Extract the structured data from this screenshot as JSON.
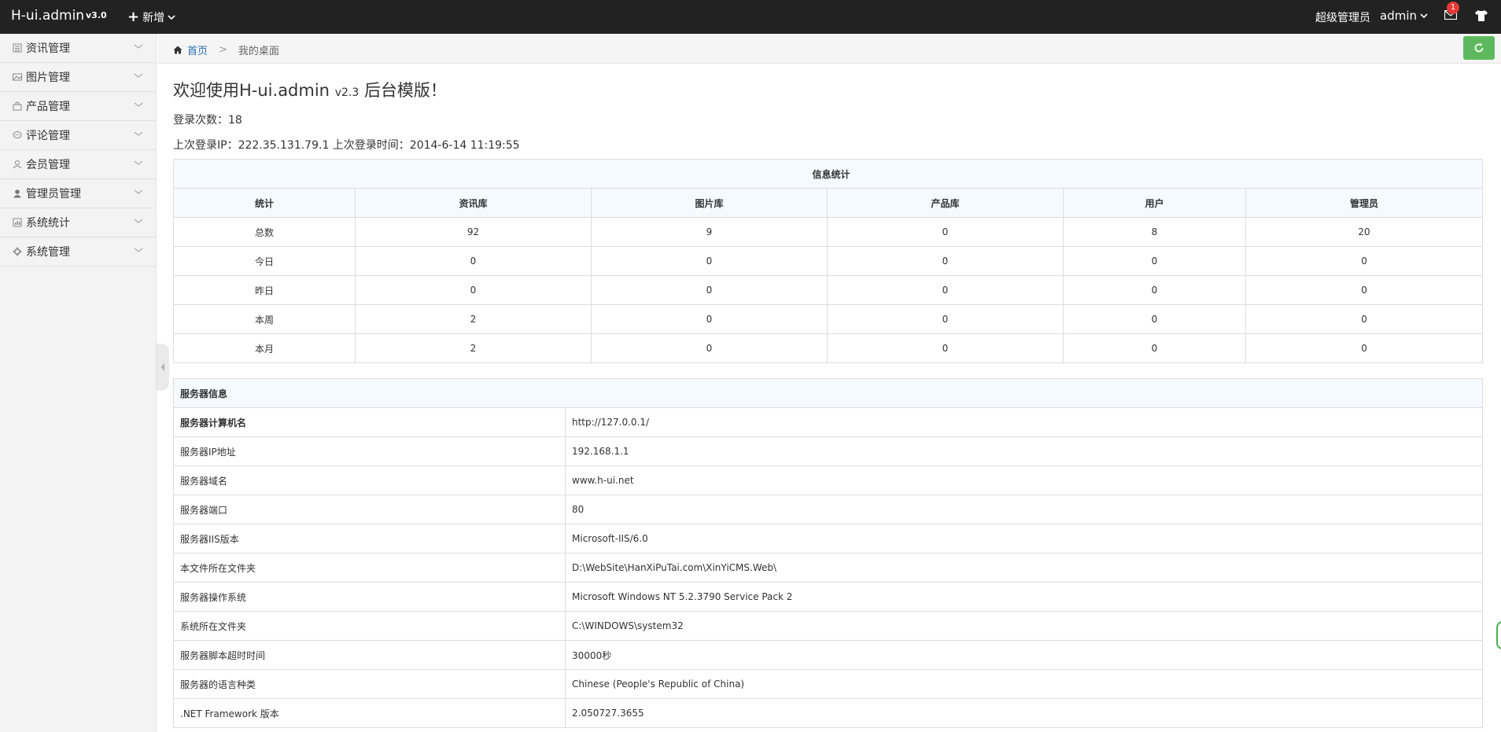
{
  "topbar": {
    "brand": "H-ui.admin",
    "version": "v3.0",
    "add_label": "新增",
    "role": "超级管理员",
    "user": "admin",
    "message_count": "1"
  },
  "sidebar": {
    "items": [
      {
        "label": "资讯管理",
        "icon": "news-icon"
      },
      {
        "label": "图片管理",
        "icon": "image-icon"
      },
      {
        "label": "产品管理",
        "icon": "bag-icon"
      },
      {
        "label": "评论管理",
        "icon": "comment-icon"
      },
      {
        "label": "会员管理",
        "icon": "member-icon"
      },
      {
        "label": "管理员管理",
        "icon": "admin-user-icon"
      },
      {
        "label": "系统统计",
        "icon": "stats-icon"
      },
      {
        "label": "系统管理",
        "icon": "gear-icon"
      }
    ]
  },
  "breadcrumb": {
    "home": "首页",
    "separator": ">",
    "current": "我的桌面"
  },
  "welcome": {
    "prefix": "欢迎使用H-ui.admin",
    "version": "v2.3",
    "suffix": "后台模版！"
  },
  "login": {
    "count_text": "登录次数：18",
    "last_text": "上次登录IP：222.35.131.79.1 上次登录时间：2014-6-14 11:19:55"
  },
  "stats": {
    "caption": "信息统计",
    "headers": [
      "统计",
      "资讯库",
      "图片库",
      "产品库",
      "用户",
      "管理员"
    ],
    "rows": [
      [
        "总数",
        "92",
        "9",
        "0",
        "8",
        "20"
      ],
      [
        "今日",
        "0",
        "0",
        "0",
        "0",
        "0"
      ],
      [
        "昨日",
        "0",
        "0",
        "0",
        "0",
        "0"
      ],
      [
        "本周",
        "2",
        "0",
        "0",
        "0",
        "0"
      ],
      [
        "本月",
        "2",
        "0",
        "0",
        "0",
        "0"
      ]
    ]
  },
  "server": {
    "caption": "服务器信息",
    "rows": [
      [
        "服务器计算机名",
        "http://127.0.0.1/"
      ],
      [
        "服务器IP地址",
        "192.168.1.1"
      ],
      [
        "服务器域名",
        "www.h-ui.net"
      ],
      [
        "服务器端口",
        "80"
      ],
      [
        "服务器IIS版本",
        "Microsoft-IIS/6.0"
      ],
      [
        "本文件所在文件夹",
        "D:\\WebSite\\HanXiPuTai.com\\XinYiCMS.Web\\"
      ],
      [
        "服务器操作系统",
        "Microsoft Windows NT 5.2.3790 Service Pack 2"
      ],
      [
        "系统所在文件夹",
        "C:\\WINDOWS\\system32"
      ],
      [
        "服务器脚本超时时间",
        "30000秒"
      ],
      [
        "服务器的语言种类",
        "Chinese (People's Republic of China)"
      ],
      [
        ".NET Framework 版本",
        "2.050727.3655"
      ]
    ]
  },
  "colors": {
    "topbar": "#222222",
    "accent_green": "#5eb95e",
    "link_blue": "#2a6fb0",
    "badge_red": "#e53935"
  }
}
